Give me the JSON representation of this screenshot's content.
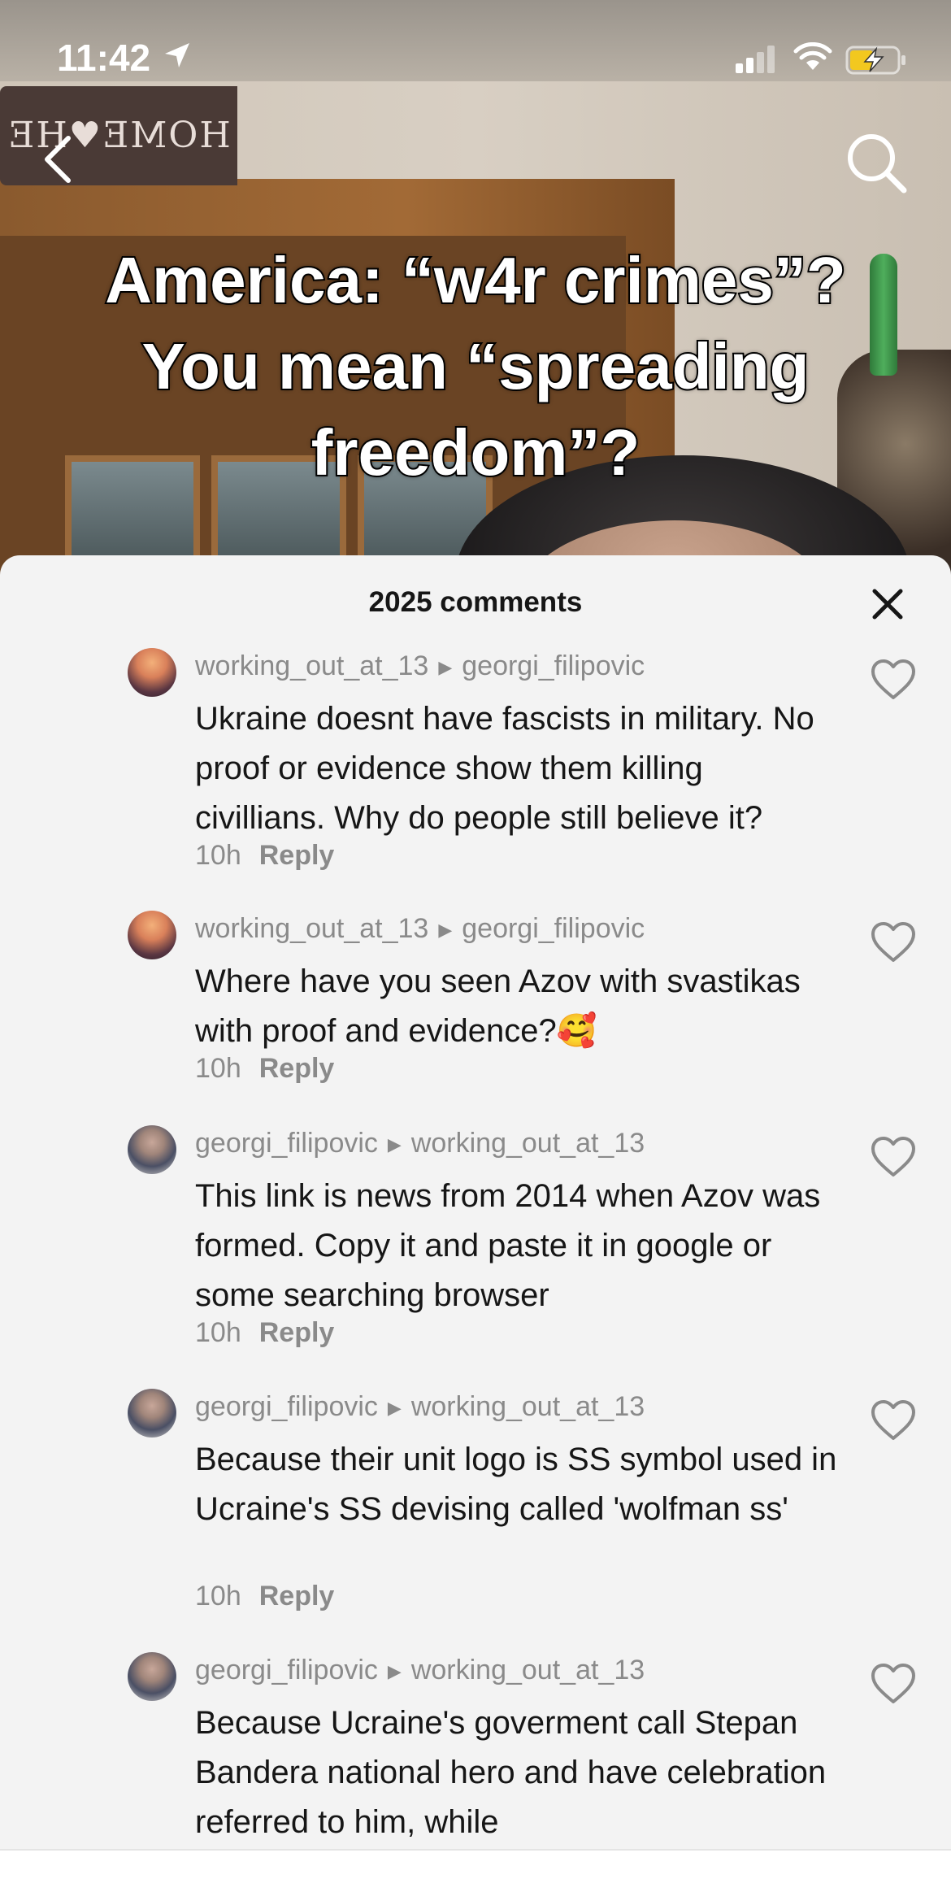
{
  "status_bar": {
    "time": "11:42"
  },
  "video": {
    "sign_text": "HOME♥HE",
    "caption_lines": [
      "America: “w4r crimes”?",
      "You mean “spreading",
      "freedom”?"
    ]
  },
  "comments_panel": {
    "count_label": "2025 comments",
    "comments": [
      {
        "author": "working_out_at_13",
        "reply_to": "georgi_filipovic",
        "text": "Ukraine doesnt have fascists in military. No proof or evidence show them killing civillians. Why do people still believe it?",
        "time": "10h",
        "reply_label": "Reply"
      },
      {
        "author": "working_out_at_13",
        "reply_to": "georgi_filipovic",
        "text": "Where have you seen Azov with svastikas with proof and evidence?🥰",
        "time": "10h",
        "reply_label": "Reply"
      },
      {
        "author": "georgi_filipovic",
        "reply_to": "working_out_at_13",
        "text": "This link is news from 2014 when Azov was formed. Copy it and paste it in google or some searching browser",
        "time": "10h",
        "reply_label": "Reply"
      },
      {
        "author": "georgi_filipovic",
        "reply_to": "working_out_at_13",
        "text": "Because their unit logo is SS symbol used in Ucraine's SS devising called 'wolfman ss'",
        "time": "10h",
        "reply_label": "Reply"
      },
      {
        "author": "georgi_filipovic",
        "reply_to": "working_out_at_13",
        "text": "Because Ucraine's goverment call Stepan Bandera national hero and have celebration referred to him, while",
        "time": "",
        "reply_label": ""
      }
    ]
  }
}
